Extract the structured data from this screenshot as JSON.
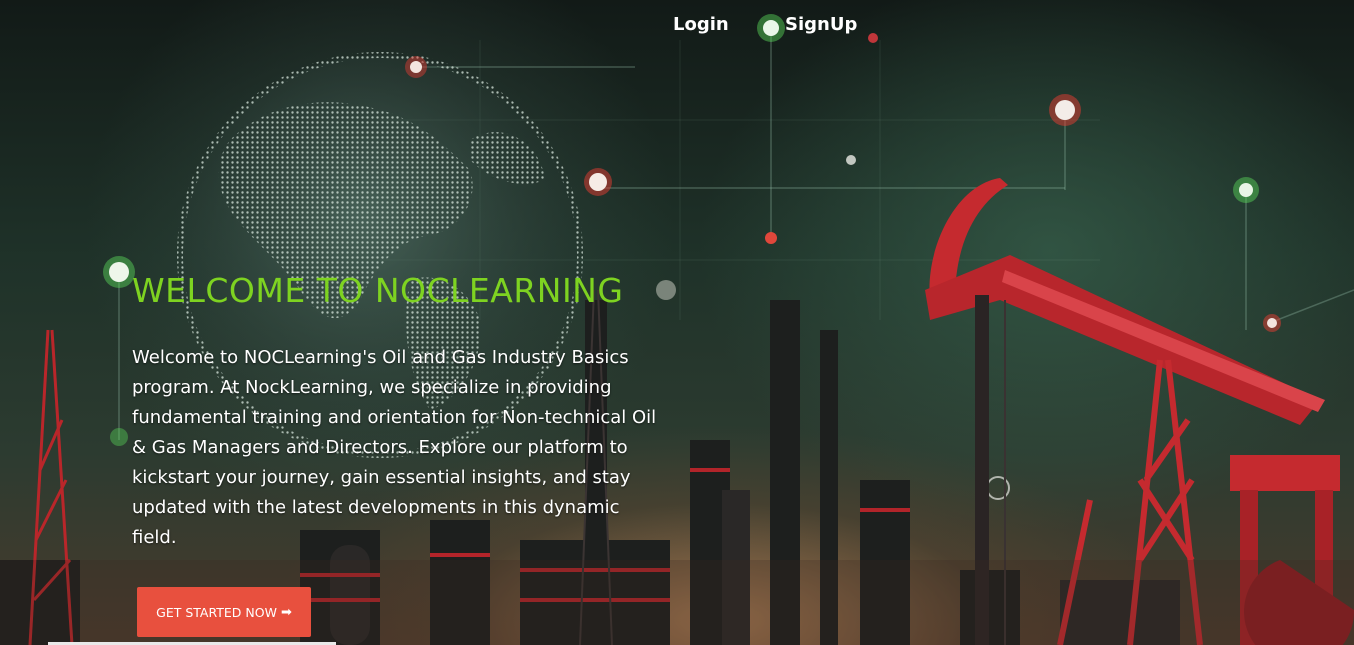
{
  "nav": {
    "login_label": "Login",
    "signup_label": "SignUp"
  },
  "hero": {
    "title": "WELCOME TO NOCLEARNING",
    "description": "Welcome to NOCLearning's Oil and Gas Industry Basics program. At NockLearning, we specialize in providing fundamental training and orientation for Non-technical Oil & Gas Managers and Directors. Explore our platform to kickstart your journey, gain essential insights, and stay updated with the latest developments in this dynamic field.",
    "cta_label": "GET STARTED NOW",
    "cta_icon": "arrow-right-icon",
    "cta_arrow": "➡"
  },
  "colors": {
    "title": "#7ed321",
    "cta_background": "#e8503e",
    "text": "#ffffff"
  }
}
